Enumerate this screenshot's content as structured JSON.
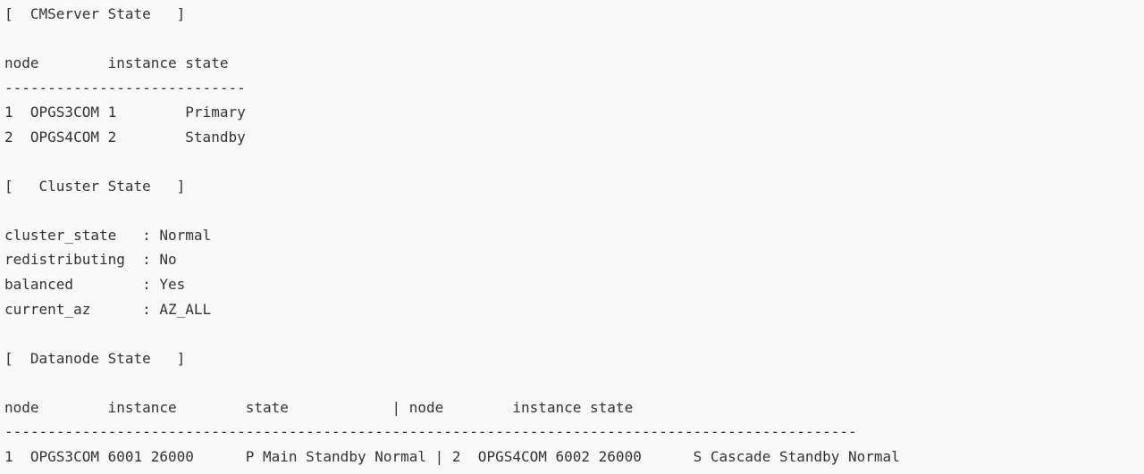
{
  "output": {
    "cmserver": {
      "header": "[  CMServer State   ]",
      "columns": "node        instance state",
      "separator": "----------------------------",
      "rows": [
        "1  OPGS3COM 1        Primary",
        "2  OPGS4COM 2        Standby"
      ]
    },
    "cluster": {
      "header": "[   Cluster State   ]",
      "rows": [
        "cluster_state   : Normal",
        "redistributing  : No",
        "balanced        : Yes",
        "current_az      : AZ_ALL"
      ]
    },
    "datanode": {
      "header": "[  Datanode State   ]",
      "columns": "node        instance        state            | node        instance state",
      "separator": "---------------------------------------------------------------------------------------------------",
      "rows": [
        "1  OPGS3COM 6001 26000      P Main Standby Normal | 2  OPGS4COM 6002 26000      S Cascade Standby Normal"
      ]
    }
  }
}
